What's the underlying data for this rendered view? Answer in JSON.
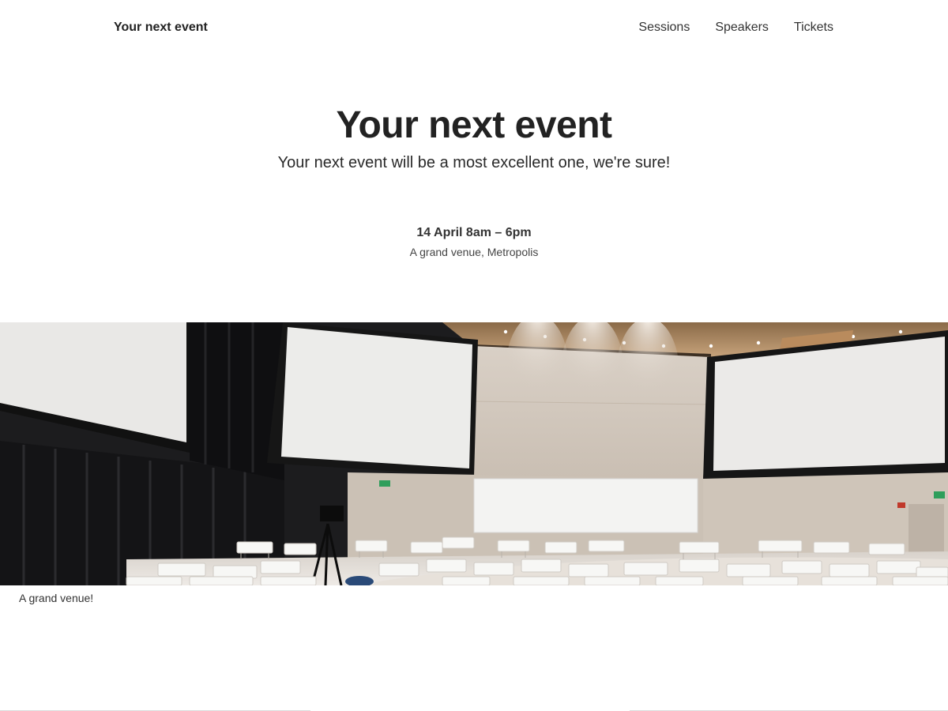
{
  "header": {
    "brand": "Your next event",
    "nav": [
      {
        "label": "Sessions"
      },
      {
        "label": "Speakers"
      },
      {
        "label": "Tickets"
      }
    ]
  },
  "hero": {
    "title": "Your next event",
    "subtitle": "Your next event will be a most excellent one, we're sure!"
  },
  "event": {
    "when": "14 April 8am – 6pm",
    "where": "A grand venue, Metropolis"
  },
  "venue_image": {
    "caption": "A grand venue!"
  }
}
